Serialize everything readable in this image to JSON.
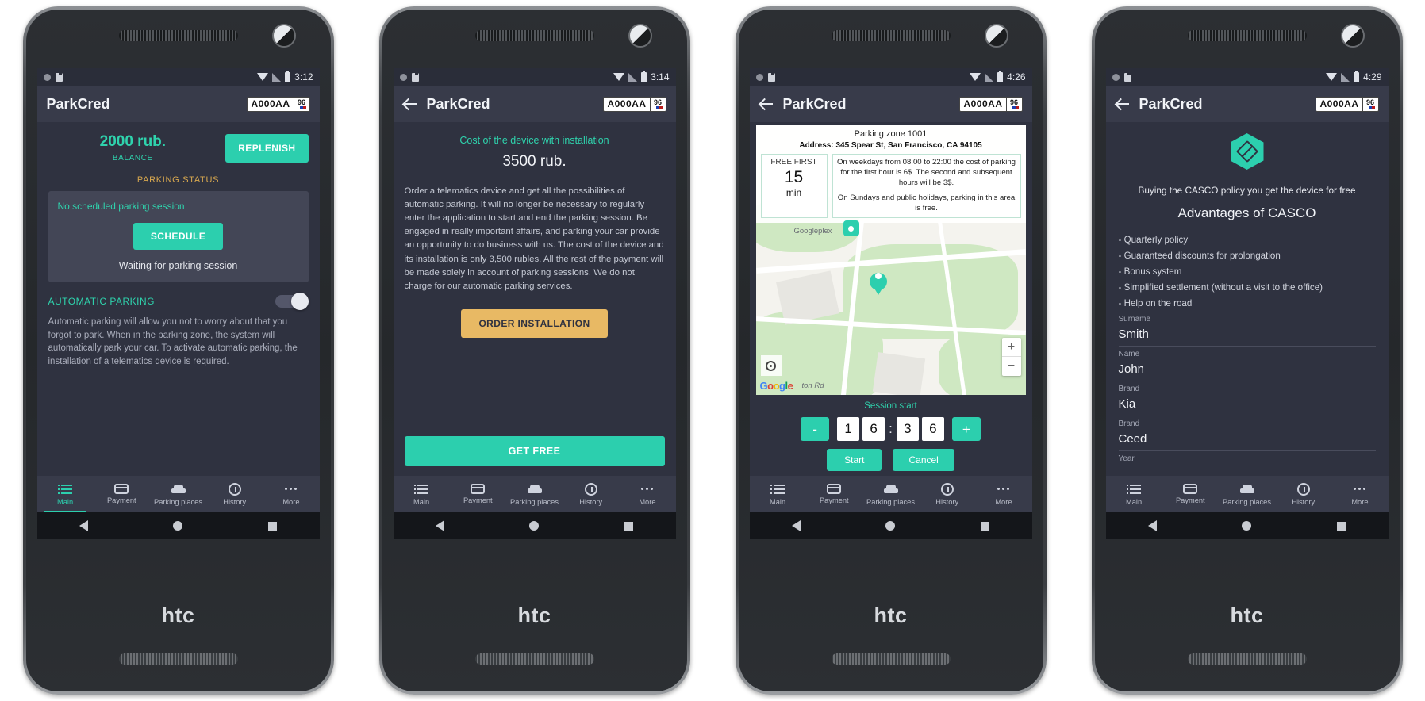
{
  "app": {
    "name": "ParkCred",
    "plate_main": "A000AA",
    "plate_region": "96",
    "plate_country": "RUS"
  },
  "tabs": [
    {
      "label": "Main",
      "icon": "list-icon"
    },
    {
      "label": "Payment",
      "icon": "card-icon"
    },
    {
      "label": "Parking places",
      "icon": "car-icon"
    },
    {
      "label": "History",
      "icon": "clock-icon"
    },
    {
      "label": "More",
      "icon": "more-icon"
    }
  ],
  "colors": {
    "accent": "#2ccfae",
    "warning": "#d8a84f",
    "order_button": "#e8b964",
    "background": "#2f3240",
    "card": "#434656",
    "appbar": "#383b4a"
  },
  "phones": [
    {
      "status": {
        "time": "3:12"
      },
      "screen": "main",
      "balance": {
        "amount": "2000 rub.",
        "label": "BALANCE",
        "replenish_label": "REPLENISH"
      },
      "parking_status": {
        "caption": "PARKING STATUS",
        "note": "No scheduled parking session",
        "schedule_label": "SCHEDULE",
        "waiting": "Waiting for parking session"
      },
      "automatic": {
        "title": "AUTOMATIC PARKING",
        "enabled": false,
        "description": "Automatic parking will allow you not to worry about that you forgot to park. When in the parking zone, the system will automatically park your car. To activate automatic parking, the installation of a telematics device is required."
      }
    },
    {
      "status": {
        "time": "3:14"
      },
      "screen": "device",
      "heading": "Cost of the device with installation",
      "price": "3500 rub.",
      "body": "Order a telematics device and get all the possibilities of automatic parking. It will no longer be necessary to regularly enter the application to start and end the parking session. Be engaged in really important affairs, and parking your car provide an opportunity to do business with us. The cost of the device and its installation is only 3,500 rubles. All the rest of the payment will be made solely in account of parking sessions. We do not charge for our automatic parking services.",
      "order_label": "ORDER INSTALLATION",
      "getfree_label": "GET FREE"
    },
    {
      "status": {
        "time": "4:26"
      },
      "screen": "map",
      "map": {
        "zone_title": "Parking zone 1001",
        "address": "Address: 345 Spear St, San Francisco, CA 94105",
        "free_caption": "FREE FIRST",
        "free_value": "15",
        "free_unit": "min",
        "rules_line1": "On weekdays from 08:00 to 22:00 the cost of parking for the first hour is 6$. The second and subsequent hours will be 3$.",
        "rules_line2": "On Sundays and public holidays, parking in this area is free.",
        "place_label": "Googleplex",
        "street_label": "ton Rd",
        "zoom_in": "+",
        "zoom_out": "−"
      },
      "session": {
        "title": "Session start",
        "minus": "-",
        "plus": "+",
        "hour_d1": "1",
        "hour_d2": "6",
        "colon": ":",
        "min_d1": "3",
        "min_d2": "6",
        "start_label": "Start",
        "cancel_label": "Cancel"
      }
    },
    {
      "status": {
        "time": "4:29"
      },
      "screen": "casco",
      "subtitle": "Buying the CASCO policy you get the device for free",
      "title": "Advantages of CASCO",
      "advantages": [
        "- Quarterly policy",
        "- Guaranteed discounts for prolongation",
        "- Bonus system",
        "- Simplified settlement (without a visit to the office)",
        "- Help on the road"
      ],
      "fields": [
        {
          "label": "Surname",
          "value": "Smith"
        },
        {
          "label": "Name",
          "value": "John"
        },
        {
          "label": "Brand",
          "value": "Kia"
        },
        {
          "label": "Brand",
          "value": "Ceed"
        },
        {
          "label": "Year",
          "value": ""
        }
      ]
    }
  ],
  "device": {
    "brand": "htc"
  }
}
